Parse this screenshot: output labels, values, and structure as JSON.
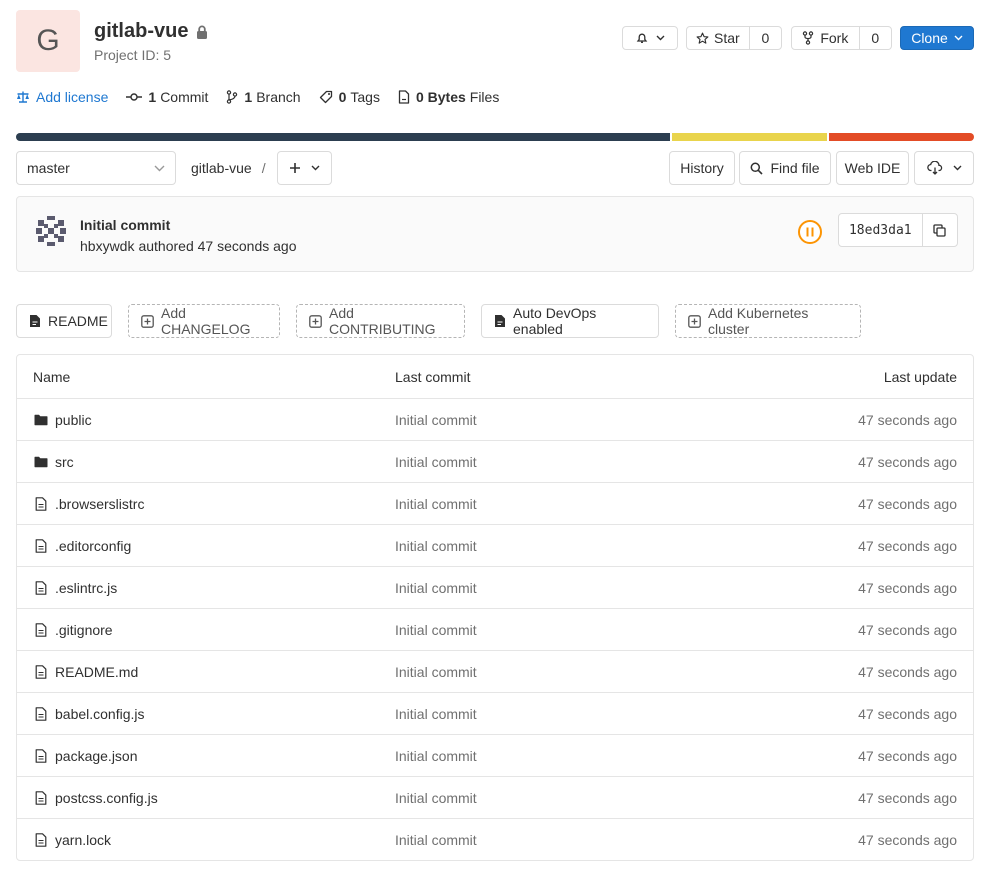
{
  "project": {
    "avatar_letter": "G",
    "name": "gitlab-vue",
    "id_text": "Project ID: 5"
  },
  "header_actions": {
    "star_label": "Star",
    "star_count": "0",
    "fork_label": "Fork",
    "fork_count": "0",
    "clone_label": "Clone"
  },
  "stats": {
    "add_license": "Add license",
    "commits_count": "1",
    "commits_label": "Commit",
    "branches_count": "1",
    "branches_label": "Branch",
    "tags_count": "0",
    "tags_label": "Tags",
    "files_size": "0 Bytes",
    "files_label": "Files"
  },
  "languages": [
    {
      "color": "#2c3e50",
      "percent": 68.5
    },
    {
      "color": "#e9d44c",
      "percent": 16.3
    },
    {
      "color": "#e34c26",
      "percent": 15.2
    }
  ],
  "nav": {
    "branch": "master",
    "breadcrumb_project": "gitlab-vue",
    "breadcrumb_sep": "/",
    "history": "History",
    "find_file": "Find file",
    "web_ide": "Web IDE"
  },
  "last_commit": {
    "title": "Initial commit",
    "author": "hbxywdk",
    "authored_text": "authored 47 seconds ago",
    "sha": "18ed3da1",
    "pipeline_color": "#fc9403"
  },
  "quick_links": {
    "readme": "README",
    "add_changelog": "Add CHANGELOG",
    "add_contributing": "Add CONTRIBUTING",
    "auto_devops": "Auto DevOps enabled",
    "add_kubernetes": "Add Kubernetes cluster"
  },
  "table": {
    "headers": {
      "name": "Name",
      "last_commit": "Last commit",
      "last_update": "Last update"
    },
    "rows": [
      {
        "type": "folder",
        "name": "public",
        "commit": "Initial commit",
        "updated": "47 seconds ago"
      },
      {
        "type": "folder",
        "name": "src",
        "commit": "Initial commit",
        "updated": "47 seconds ago"
      },
      {
        "type": "file",
        "name": ".browserslistrc",
        "commit": "Initial commit",
        "updated": "47 seconds ago"
      },
      {
        "type": "file",
        "name": ".editorconfig",
        "commit": "Initial commit",
        "updated": "47 seconds ago"
      },
      {
        "type": "file",
        "name": ".eslintrc.js",
        "commit": "Initial commit",
        "updated": "47 seconds ago"
      },
      {
        "type": "file",
        "name": ".gitignore",
        "commit": "Initial commit",
        "updated": "47 seconds ago"
      },
      {
        "type": "file",
        "name": "README.md",
        "commit": "Initial commit",
        "updated": "47 seconds ago"
      },
      {
        "type": "file",
        "name": "babel.config.js",
        "commit": "Initial commit",
        "updated": "47 seconds ago"
      },
      {
        "type": "file",
        "name": "package.json",
        "commit": "Initial commit",
        "updated": "47 seconds ago"
      },
      {
        "type": "file",
        "name": "postcss.config.js",
        "commit": "Initial commit",
        "updated": "47 seconds ago"
      },
      {
        "type": "file",
        "name": "yarn.lock",
        "commit": "Initial commit",
        "updated": "47 seconds ago"
      }
    ]
  },
  "colors": {
    "link": "#1f78d1",
    "clone_button": "#1f78d1"
  }
}
